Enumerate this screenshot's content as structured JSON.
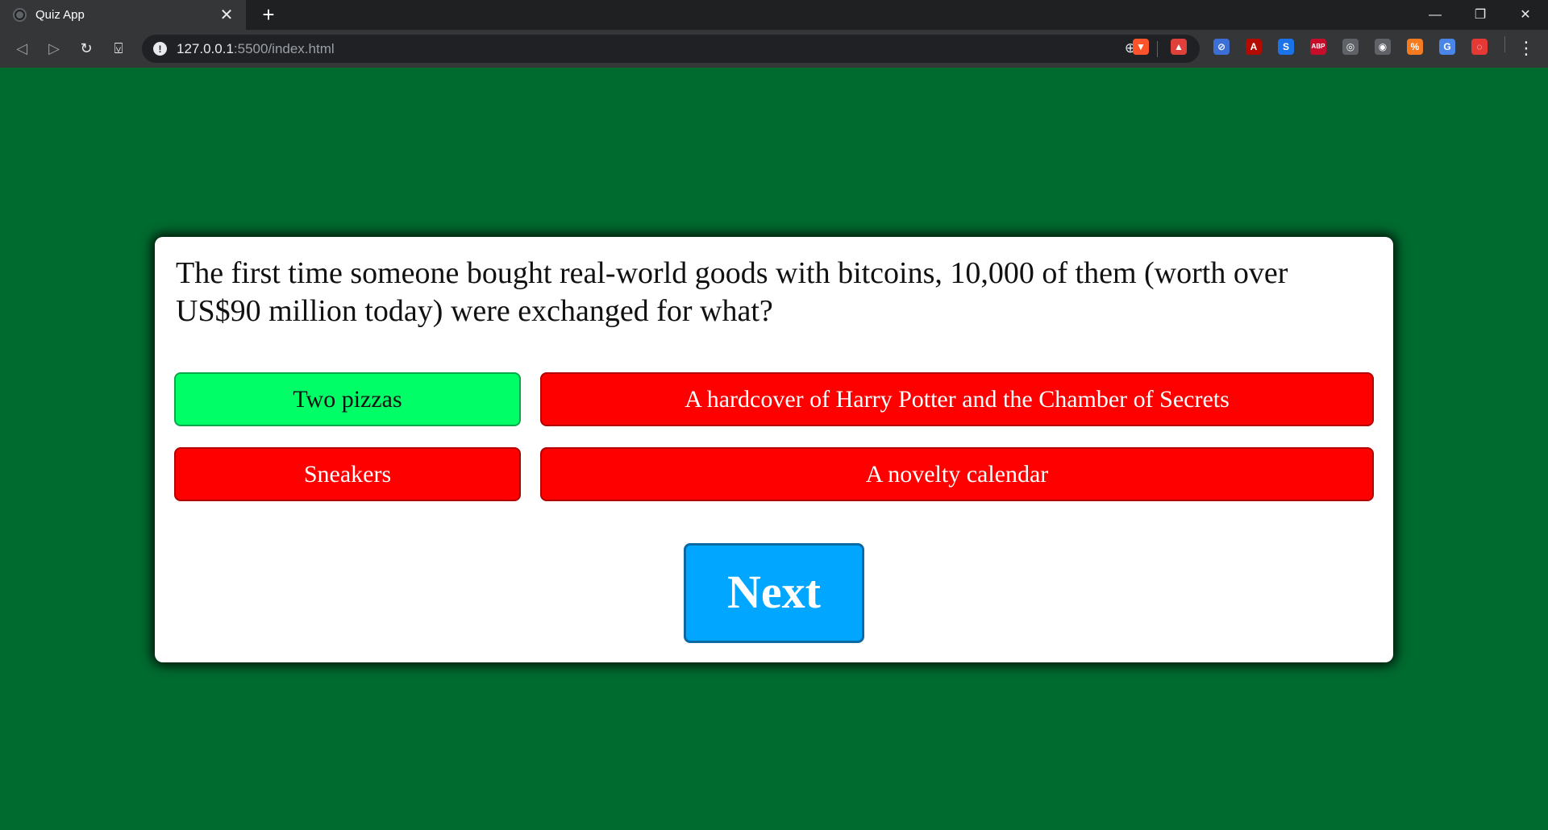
{
  "browser": {
    "tab_title": "Quiz App",
    "tab_close": "✕",
    "new_tab": "+",
    "url_host": "127.0.0.1",
    "url_rest": ":5500/index.html",
    "window_controls": {
      "minimize": "—",
      "restore": "❐",
      "close": "✕"
    },
    "nav": {
      "back": "◁",
      "forward": "▷",
      "reload": "↻",
      "bookmark": "⍌"
    },
    "extensions": [
      {
        "name": "brave-shields-icon",
        "color": "#fb542b",
        "label": "▼"
      },
      {
        "name": "brave-rewards-icon",
        "color": "#e0403a",
        "label": "▲"
      },
      {
        "name": "block-icon",
        "color": "#3b6fd6",
        "label": "⊘"
      },
      {
        "name": "acrobat-icon",
        "color": "#b30b00",
        "label": "A"
      },
      {
        "name": "s-extension-icon",
        "color": "#1a73e8",
        "label": "S"
      },
      {
        "name": "adblock-plus-icon",
        "color": "#c70d2c",
        "label": "ABP"
      },
      {
        "name": "globe-extension-icon",
        "color": "#5f6368",
        "label": "◎"
      },
      {
        "name": "camera-icon",
        "color": "#5f6368",
        "label": "◉"
      },
      {
        "name": "percent-extension-icon",
        "color": "#f47b20",
        "label": "%"
      },
      {
        "name": "translate-icon",
        "color": "#4a86e8",
        "label": "G"
      },
      {
        "name": "spiral-extension-icon",
        "color": "#e53935",
        "label": "◌"
      }
    ],
    "menu": "⋮"
  },
  "quiz": {
    "question": "The first time someone bought real-world goods with bitcoins, 10,000 of them (worth over US$90 million today) were exchanged for what?",
    "answers": [
      {
        "label": "Two pizzas",
        "state": "correct"
      },
      {
        "label": "A hardcover of Harry Potter and the Chamber of Secrets",
        "state": "wrong"
      },
      {
        "label": "Sneakers",
        "state": "wrong"
      },
      {
        "label": "A novelty calendar",
        "state": "wrong"
      }
    ],
    "next_label": "Next"
  },
  "colors": {
    "page_background": "#006b2f",
    "correct": "#00ff66",
    "wrong": "#ff0000",
    "next": "#00a6ff"
  }
}
